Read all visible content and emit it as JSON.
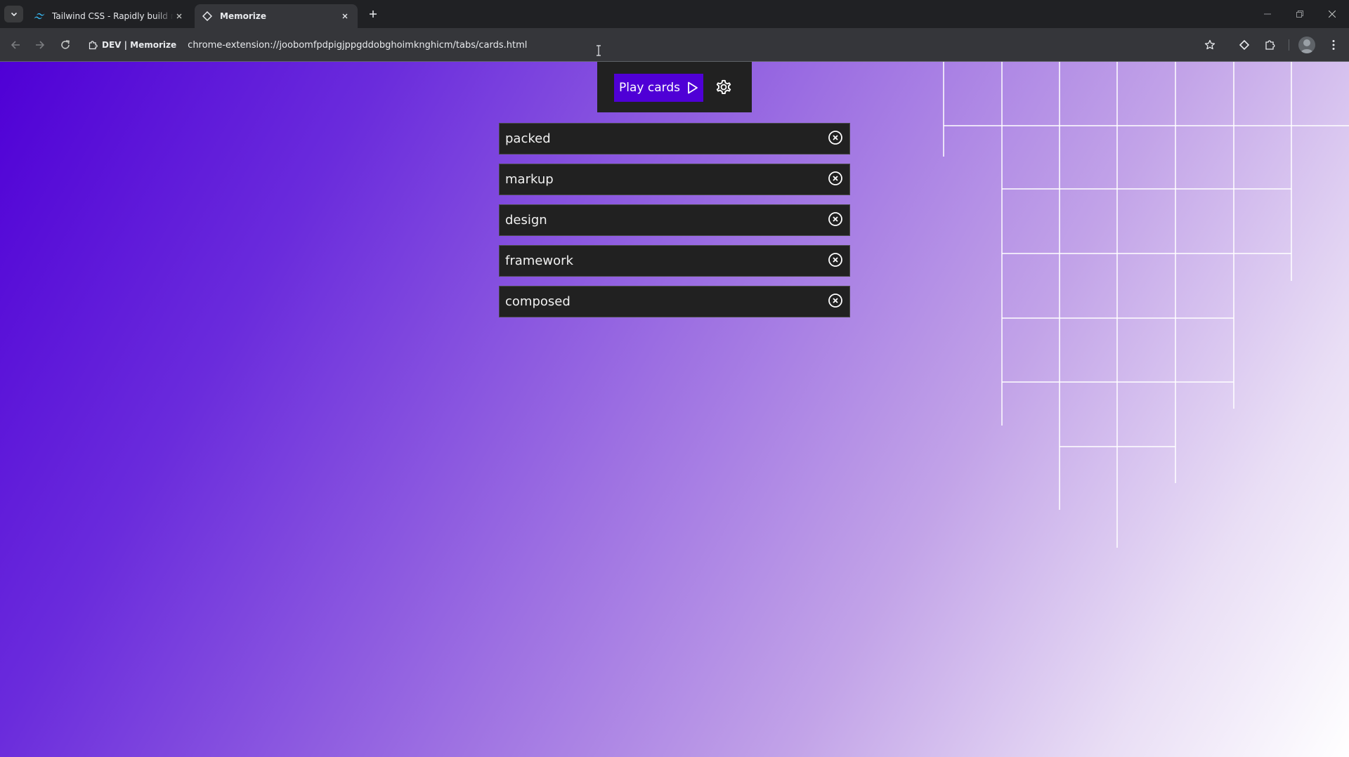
{
  "browser": {
    "tabs": [
      {
        "title": "Tailwind CSS - Rapidly build m",
        "active": false,
        "icon": "tailwind-logo-icon"
      },
      {
        "title": "Memorize",
        "active": true,
        "icon": "extension-diamond-icon"
      }
    ],
    "new_tab_label": "+",
    "site_chip": "DEV | Memorize",
    "url": "chrome-extension://joobomfpdpigjppgddobghoimknghicm/tabs/cards.html"
  },
  "page": {
    "play_button_label": "Play cards",
    "cards": [
      {
        "word": "packed"
      },
      {
        "word": "markup"
      },
      {
        "word": "design"
      },
      {
        "word": "framework"
      },
      {
        "word": "composed"
      }
    ]
  },
  "colors": {
    "accent": "#4f00d6",
    "panel": "#212121",
    "gradient_start": "#4f00d6",
    "gradient_end": "#ffffff"
  }
}
